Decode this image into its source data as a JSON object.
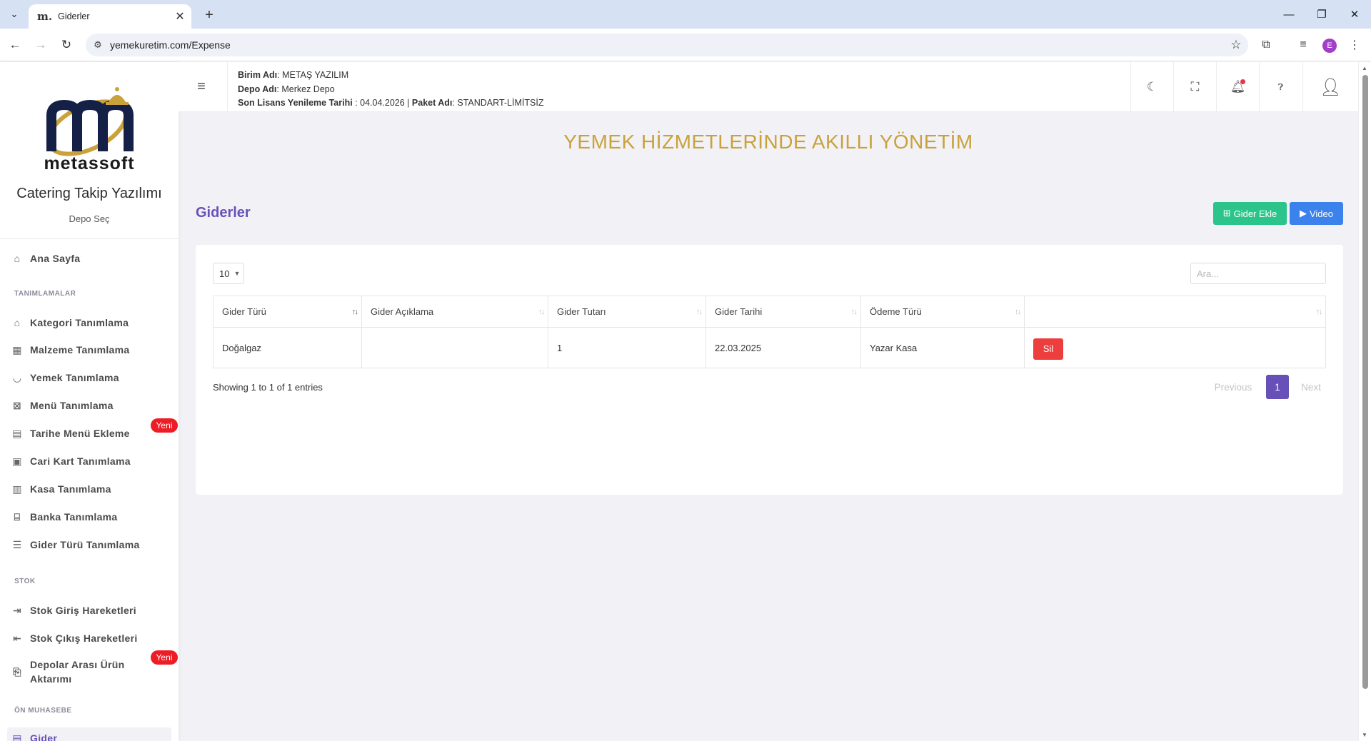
{
  "browser": {
    "tab_title": "Giderler",
    "tab_favicon": "m.",
    "url": "yemekuretim.com/Expense",
    "profile_initial": "E"
  },
  "sidebar": {
    "logo_text": "metassoft",
    "brand": "Catering Takip Yazılımı",
    "depo_select": "Depo Seç",
    "home": "Ana Sayfa",
    "sections": {
      "tanimlamalar": "TANIMLAMALAR",
      "stok": "STOK",
      "on_muhasebe": "ÖN MUHASEBE"
    },
    "items": [
      {
        "label": "Kategori Tanımlama",
        "icon": "tag-icon"
      },
      {
        "label": "Malzeme Tanımlama",
        "icon": "box-icon"
      },
      {
        "label": "Yemek Tanımlama",
        "icon": "bowl-icon"
      },
      {
        "label": "Menü Tanımlama",
        "icon": "menu-icon"
      },
      {
        "label": "Tarihe Menü Ekleme",
        "icon": "calendar-icon"
      },
      {
        "label": "Cari Kart Tanımlama",
        "icon": "card-icon"
      },
      {
        "label": "Kasa Tanımlama",
        "icon": "register-icon"
      },
      {
        "label": "Banka Tanımlama",
        "icon": "bank-icon"
      },
      {
        "label": "Gider Türü Tanımlama",
        "icon": "list-icon"
      }
    ],
    "stock_items": [
      {
        "label": "Stok Giriş Hareketleri",
        "icon": "stock-in-icon"
      },
      {
        "label": "Stok Çıkış Hareketleri",
        "icon": "stock-out-icon"
      },
      {
        "label": "Depolar Arası Ürün Aktarımı",
        "icon": "transfer-icon"
      }
    ],
    "active_item": "Gider",
    "badge": "Yeni"
  },
  "header": {
    "birim_label": "Birim Adı",
    "birim_value": "METAŞ YAZILIM",
    "depo_label": "Depo Adı",
    "depo_value": "Merkez Depo",
    "lisans_label": "Son Lisans Yenileme Tarihi",
    "lisans_value": "04.04.2026",
    "paket_label": "Paket Adı",
    "paket_value": "STANDART-LİMİTSİZ"
  },
  "main": {
    "hero": "YEMEK HİZMETLERİNDE AKILLI YÖNETİM",
    "page_title": "Giderler",
    "add_button": "Gider Ekle",
    "video_button": "Video",
    "page_length": "10",
    "search_placeholder": "Ara...",
    "columns": [
      "Gider Türü",
      "Gider Açıklama",
      "Gider Tutarı",
      "Gider Tarihi",
      "Ödeme Türü",
      ""
    ],
    "rows": [
      {
        "tur": "Doğalgaz",
        "aciklama": "",
        "tutar": "1",
        "tarih": "22.03.2025",
        "odeme": "Yazar Kasa",
        "action": "Sil"
      }
    ],
    "info": "Showing 1 to 1 of 1 entries",
    "prev": "Previous",
    "page": "1",
    "next": "Next"
  }
}
